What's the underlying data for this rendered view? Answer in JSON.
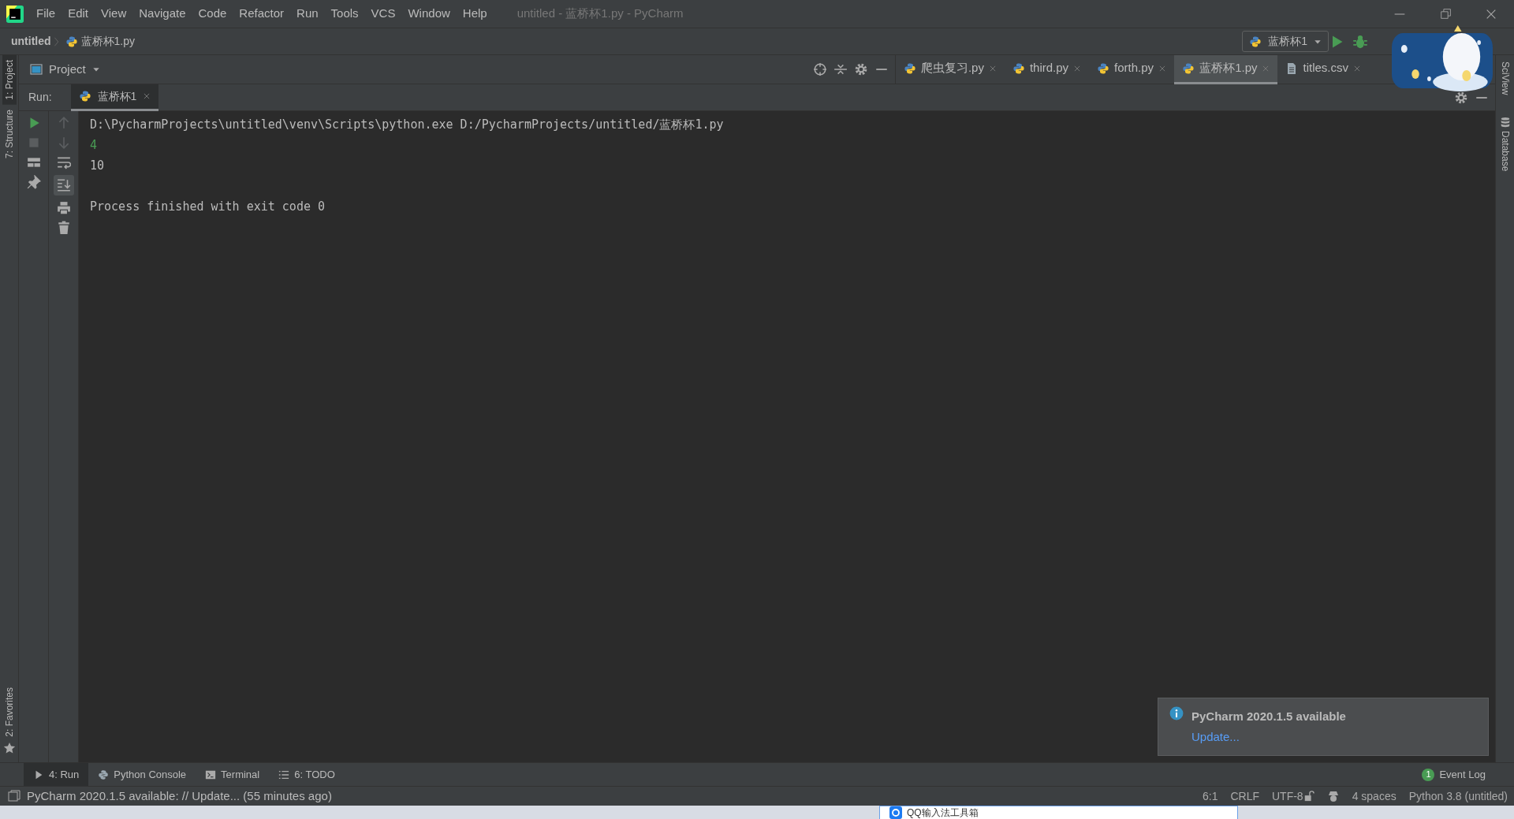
{
  "window": {
    "title": "untitled - 蓝桥杯1.py - PyCharm"
  },
  "menu": [
    "File",
    "Edit",
    "View",
    "Navigate",
    "Code",
    "Refactor",
    "Run",
    "Tools",
    "VCS",
    "Window",
    "Help"
  ],
  "breadcrumb": [
    "untitled",
    "蓝桥杯1.py"
  ],
  "run_config": "蓝桥杯1",
  "project_pane": {
    "title": "Project"
  },
  "editor_tabs": [
    {
      "label": "爬虫复习.py",
      "kind": "python",
      "selected": false
    },
    {
      "label": "third.py",
      "kind": "python",
      "selected": false
    },
    {
      "label": "forth.py",
      "kind": "python",
      "selected": false
    },
    {
      "label": "蓝桥杯1.py",
      "kind": "python",
      "selected": true
    },
    {
      "label": "titles.csv",
      "kind": "csv",
      "selected": false
    }
  ],
  "left_stripe": [
    {
      "label": "1: Project",
      "selected": true
    },
    {
      "label": "7: Structure",
      "selected": false
    }
  ],
  "favorites": "2: Favorites",
  "right_stripe": [
    "SciView",
    "Database"
  ],
  "run_panel": {
    "label": "Run:",
    "tab": "蓝桥杯1",
    "lines": [
      {
        "text": "D:\\PycharmProjects\\untitled\\venv\\Scripts\\python.exe D:/PycharmProjects/untitled/蓝桥杯1.py",
        "kind": "plain"
      },
      {
        "text": "4",
        "kind": "green"
      },
      {
        "text": "10",
        "kind": "plain"
      },
      {
        "text": "Process finished with exit code 0",
        "kind": "exit"
      }
    ]
  },
  "notification": {
    "title": "PyCharm 2020.1.5 available",
    "link": "Update..."
  },
  "bottom_tabs": [
    {
      "label": "4: Run",
      "kind": "run",
      "selected": true
    },
    {
      "label": "Python Console",
      "kind": "python",
      "selected": false
    },
    {
      "label": "Terminal",
      "kind": "terminal",
      "selected": false
    },
    {
      "label": "6: TODO",
      "kind": "todo",
      "selected": false
    }
  ],
  "event_log": {
    "count": "1",
    "label": "Event Log"
  },
  "status_bar": {
    "message": "PyCharm 2020.1.5 available: // Update... (55 minutes ago)",
    "items": [
      "6:1",
      "CRLF",
      "UTF-8",
      "4 spaces",
      "Python 3.8 (untitled)"
    ]
  },
  "popup": {
    "title": "QQ输入法工具箱"
  }
}
